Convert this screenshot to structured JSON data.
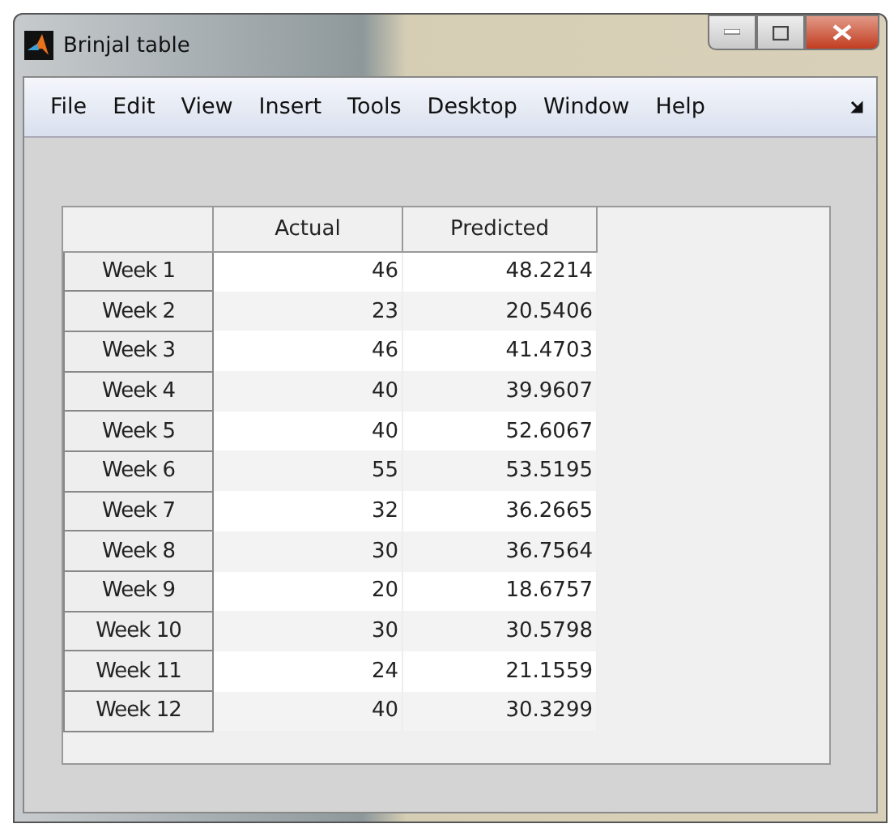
{
  "window": {
    "title": "Brinjal table"
  },
  "menu": [
    "File",
    "Edit",
    "View",
    "Insert",
    "Tools",
    "Desktop",
    "Window",
    "Help"
  ],
  "table": {
    "columns": [
      "Actual",
      "Predicted"
    ],
    "rows": [
      {
        "label": "Week 1",
        "cells": [
          "46",
          "48.2214"
        ]
      },
      {
        "label": "Week 2",
        "cells": [
          "23",
          "20.5406"
        ]
      },
      {
        "label": "Week 3",
        "cells": [
          "46",
          "41.4703"
        ]
      },
      {
        "label": "Week 4",
        "cells": [
          "40",
          "39.9607"
        ]
      },
      {
        "label": "Week 5",
        "cells": [
          "40",
          "52.6067"
        ]
      },
      {
        "label": "Week 6",
        "cells": [
          "55",
          "53.5195"
        ]
      },
      {
        "label": "Week 7",
        "cells": [
          "32",
          "36.2665"
        ]
      },
      {
        "label": "Week 8",
        "cells": [
          "30",
          "36.7564"
        ]
      },
      {
        "label": "Week 9",
        "cells": [
          "20",
          "18.6757"
        ]
      },
      {
        "label": "Week 10",
        "cells": [
          "30",
          "30.5798"
        ]
      },
      {
        "label": "Week 11",
        "cells": [
          "24",
          "21.1559"
        ]
      },
      {
        "label": "Week 12",
        "cells": [
          "40",
          "30.3299"
        ]
      }
    ]
  }
}
